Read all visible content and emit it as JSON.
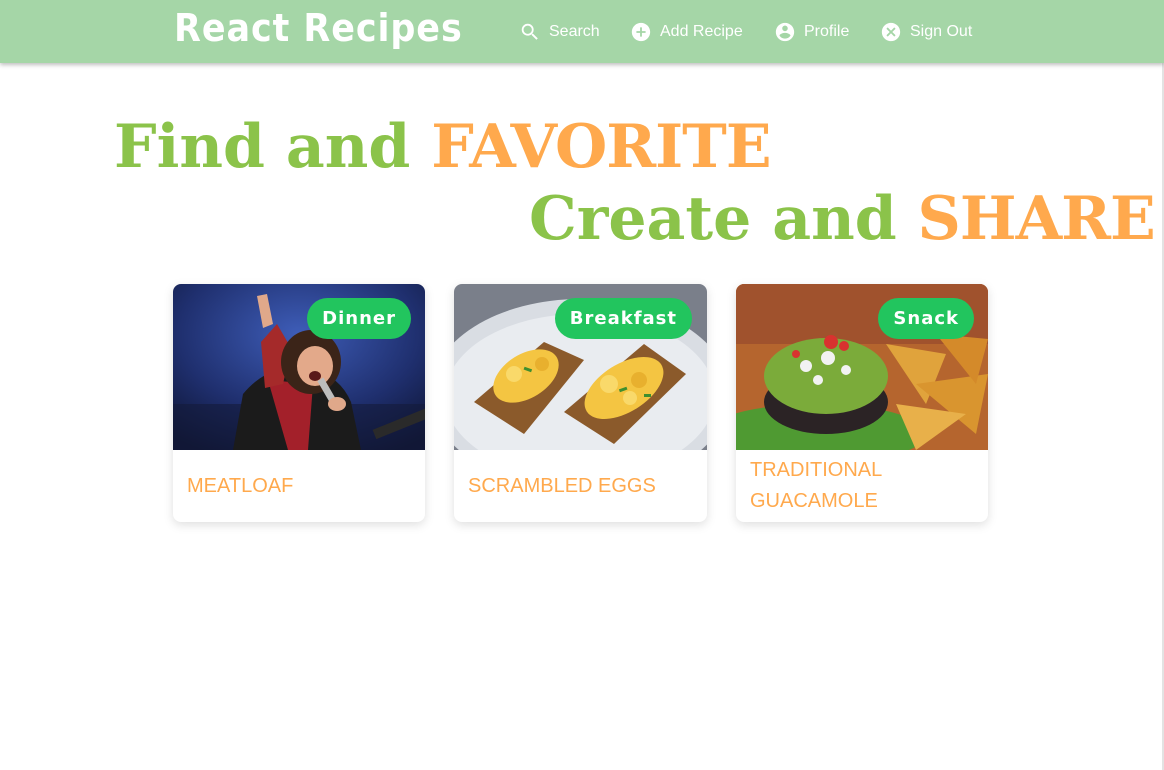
{
  "navbar": {
    "brand": "React Recipes",
    "links": [
      {
        "label": "Search",
        "icon": "search-icon"
      },
      {
        "label": "Add Recipe",
        "icon": "add-circle-icon"
      },
      {
        "label": "Profile",
        "icon": "account-circle-icon"
      },
      {
        "label": "Sign Out",
        "icon": "cancel-circle-icon"
      }
    ]
  },
  "hero": {
    "line1": {
      "light": "Find and ",
      "bold": "FAVORITE"
    },
    "line2": {
      "light": "Create and ",
      "bold": "SHARE"
    }
  },
  "recipes": [
    {
      "name": "MEATLOAF",
      "category": "Dinner"
    },
    {
      "name": "SCRAMBLED EGGS",
      "category": "Breakfast"
    },
    {
      "name": "TRADITIONAL GUACAMOLE",
      "category": "Snack"
    }
  ],
  "colors": {
    "navbar": "#a5d6a7",
    "hero_light": "#8bc34a",
    "hero_accent": "#ffa94d",
    "badge": "#22c55e",
    "card_title": "#ffa94d"
  }
}
